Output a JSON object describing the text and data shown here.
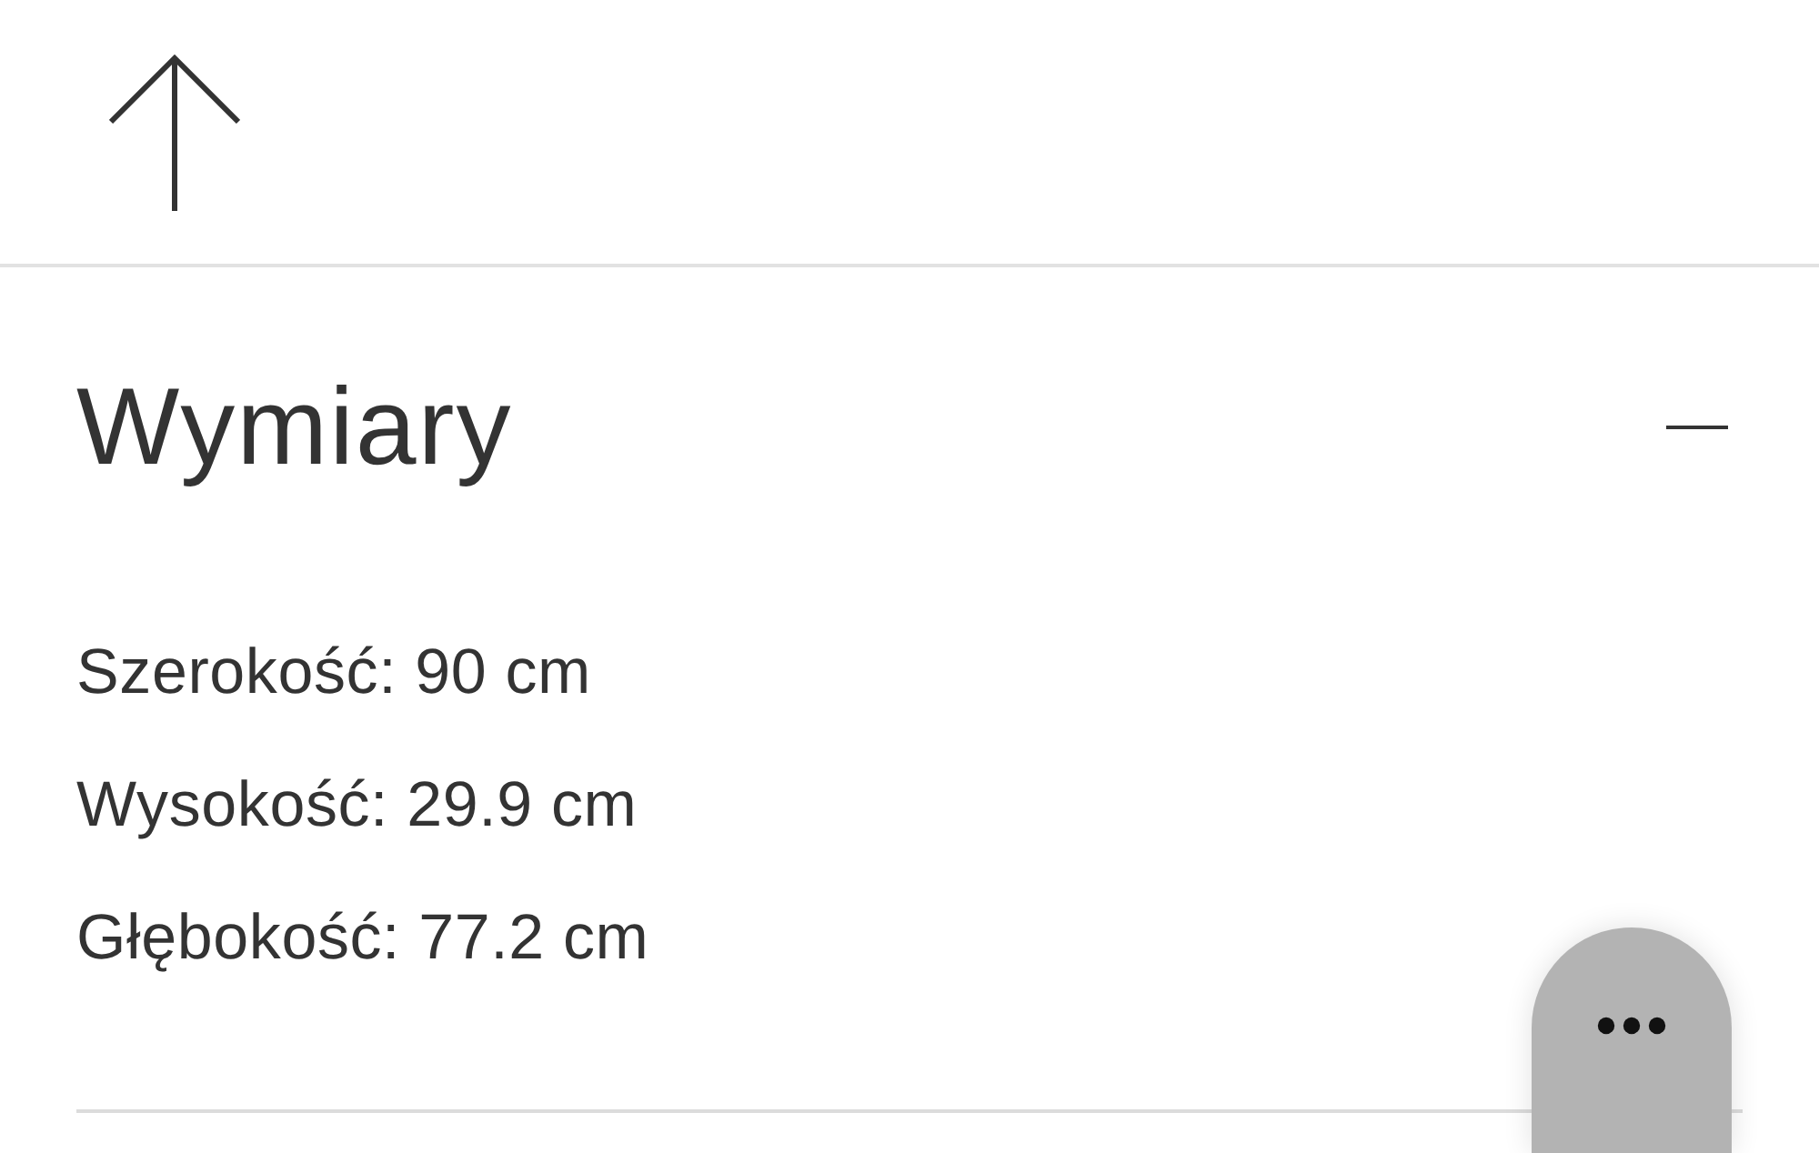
{
  "section": {
    "title": "Wymiary",
    "expanded": true,
    "items": [
      "Szerokość: 90 cm",
      "Wysokość: 29.9 cm",
      "Głębokość: 77.2 cm"
    ]
  }
}
